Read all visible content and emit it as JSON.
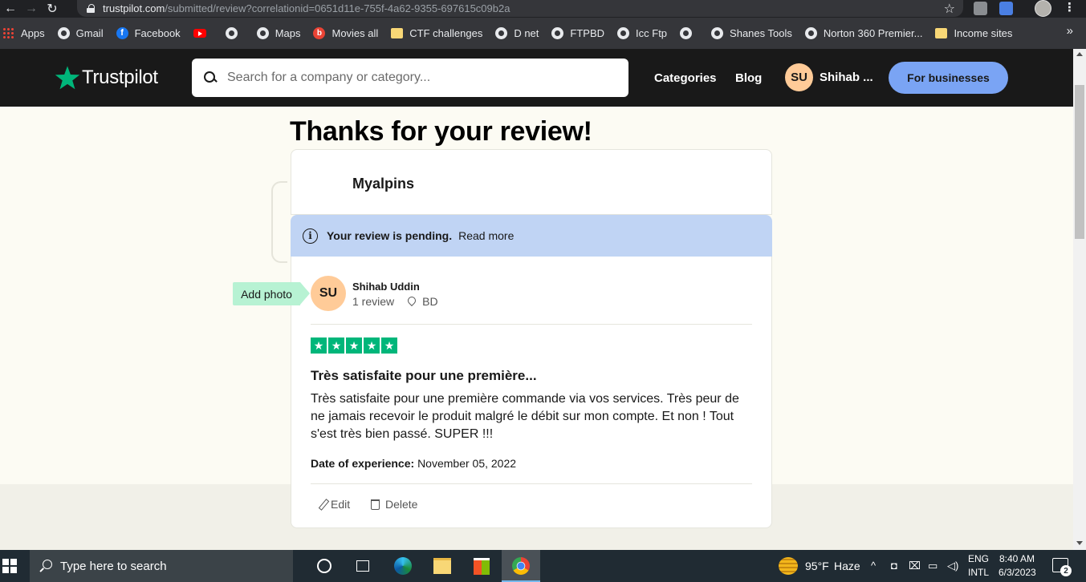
{
  "browser": {
    "url_host": "trustpilot.com",
    "url_path": "/submitted/review?correlationid=0651d11e-755f-4a62-9355-697615c09b2a",
    "bookmarks": [
      {
        "label": "Apps",
        "icon": "apps-grid-icon"
      },
      {
        "label": "Gmail",
        "icon": "globe-icon"
      },
      {
        "label": "Facebook",
        "icon": "facebook-icon"
      },
      {
        "label": "",
        "icon": "youtube-icon"
      },
      {
        "label": "",
        "icon": "globe-icon"
      },
      {
        "label": "Maps",
        "icon": "globe-icon"
      },
      {
        "label": "Movies all",
        "icon": "movies-icon"
      },
      {
        "label": "CTF challenges",
        "icon": "folder-icon"
      },
      {
        "label": "D net",
        "icon": "globe-icon"
      },
      {
        "label": "FTPBD",
        "icon": "globe-icon"
      },
      {
        "label": "Icc Ftp",
        "icon": "globe-icon"
      },
      {
        "label": "",
        "icon": "globe-icon"
      },
      {
        "label": "Shanes Tools",
        "icon": "globe-icon"
      },
      {
        "label": "Norton 360 Premier...",
        "icon": "globe-icon"
      },
      {
        "label": "Income sites",
        "icon": "folder-icon"
      }
    ],
    "more_bookmarks": "»"
  },
  "header": {
    "logo_text": "Trustpilot",
    "search_placeholder": "Search for a company or category...",
    "nav": {
      "categories": "Categories",
      "blog": "Blog"
    },
    "user_initials": "SU",
    "user_name": "Shihab ...",
    "business_button": "For businesses"
  },
  "page": {
    "title": "Thanks for your review!",
    "company_name": "Myalpins",
    "pending_text": "Your review is pending.",
    "read_more": "Read more",
    "add_photo": "Add photo",
    "reviewer": {
      "initials": "SU",
      "name": "Shihab Uddin",
      "review_count": "1 review",
      "country": "BD"
    },
    "rating": 5,
    "review_title": "Très satisfaite pour une première...",
    "review_body": "Très satisfaite pour une première commande via vos services. Très peur de ne jamais recevoir le produit malgré le débit sur mon compte. Et non ! Tout s'est très bien passé. SUPER !!!",
    "date_label": "Date of experience:",
    "date_value": "November 05, 2022",
    "actions": {
      "edit": "Edit",
      "delete": "Delete"
    }
  },
  "taskbar": {
    "search_placeholder": "Type here to search",
    "weather_temp": "95°F",
    "weather_condition": "Haze",
    "lang_1": "ENG",
    "lang_2": "INTL",
    "time": "8:40 AM",
    "date": "6/3/2023",
    "notification_count": "2"
  },
  "colors": {
    "trustpilot_green": "#00b67a",
    "header_bg": "#191919",
    "business_button": "#7aa4f4",
    "pending_bar": "#c0d4f4",
    "avatar": "#ffcb98",
    "add_photo": "#b7f2d3"
  }
}
